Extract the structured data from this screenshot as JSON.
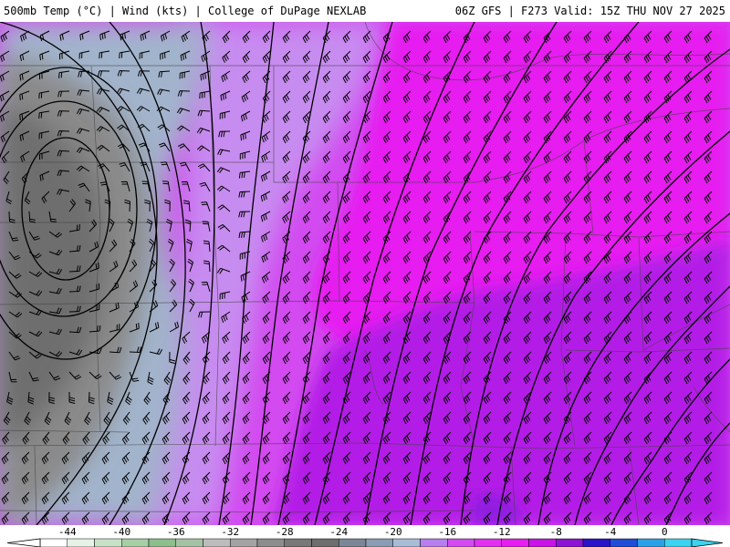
{
  "header": {
    "title": "500mb Temp (°C) | Wind (kts) | College of DuPage NEXLAB",
    "run": "06Z GFS | F273 Valid: 15Z THU NOV 27 2025"
  },
  "colorbar": {
    "tick_labels": [
      "-44",
      "-40",
      "-36",
      "-32",
      "-28",
      "-24",
      "-20",
      "-16",
      "-12",
      "-8",
      "-4",
      "0"
    ],
    "tick_values": [
      -44,
      -40,
      -36,
      -32,
      -28,
      -24,
      -20,
      -16,
      -12,
      -8,
      -4,
      0
    ],
    "range": [
      -46,
      2
    ],
    "swatches": [
      {
        "from": -46,
        "to": -44,
        "color": "#ffffff"
      },
      {
        "from": -44,
        "to": -42,
        "color": "#e6f2e6"
      },
      {
        "from": -42,
        "to": -40,
        "color": "#c8e2c8"
      },
      {
        "from": -40,
        "to": -38,
        "color": "#a6cfa6"
      },
      {
        "from": -38,
        "to": -36,
        "color": "#8cbf8c"
      },
      {
        "from": -36,
        "to": -34,
        "color": "#a5c2a5"
      },
      {
        "from": -34,
        "to": -32,
        "color": "#bcbcbc"
      },
      {
        "from": -32,
        "to": -30,
        "color": "#a3a3a3"
      },
      {
        "from": -30,
        "to": -28,
        "color": "#8d8d8d"
      },
      {
        "from": -28,
        "to": -26,
        "color": "#787878"
      },
      {
        "from": -26,
        "to": -24,
        "color": "#6e6e6e"
      },
      {
        "from": -24,
        "to": -22,
        "color": "#7b8796"
      },
      {
        "from": -22,
        "to": -20,
        "color": "#8b9db5"
      },
      {
        "from": -20,
        "to": -18,
        "color": "#a7bcd6"
      },
      {
        "from": -18,
        "to": -16,
        "color": "#b87ef0"
      },
      {
        "from": -16,
        "to": -14,
        "color": "#d24af0"
      },
      {
        "from": -14,
        "to": -12,
        "color": "#e030f0"
      },
      {
        "from": -12,
        "to": -10,
        "color": "#e61ef0"
      },
      {
        "from": -10,
        "to": -8,
        "color": "#c814e6"
      },
      {
        "from": -8,
        "to": -6,
        "color": "#8c14d2"
      },
      {
        "from": -6,
        "to": -4,
        "color": "#2a14c8"
      },
      {
        "from": -4,
        "to": -2,
        "color": "#1e4ed6"
      },
      {
        "from": -2,
        "to": 0,
        "color": "#2aa0e6"
      },
      {
        "from": 0,
        "to": 2,
        "color": "#3cd2f0"
      }
    ]
  },
  "map_colors": {
    "gray_dark": "#6e6e6e",
    "gray_mid": "#8a8a8a",
    "blue_gray": "#a2b4cc",
    "light_purple": "#c78cf0",
    "magenta": "#d24af0",
    "bright_magenta": "#e61ef0",
    "violet": "#b31de6",
    "deep_violet": "#8e1ee0",
    "contour": "#000000",
    "border": "#444444"
  }
}
